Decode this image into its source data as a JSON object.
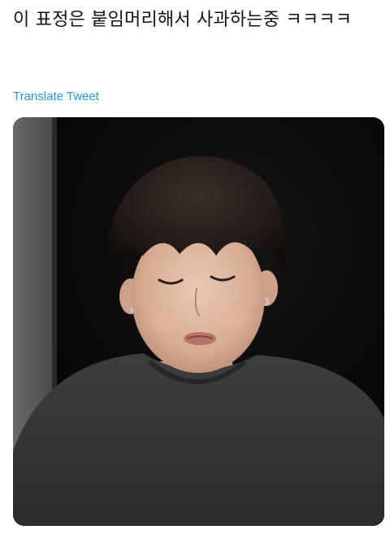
{
  "tweet": {
    "text": "이 표정은 붙임머리해서 사과하는중 ㅋㅋㅋㅋ",
    "translate_label": "Translate Tweet"
  },
  "colors": {
    "link": "#1d9bf0",
    "text": "#0f1419"
  }
}
